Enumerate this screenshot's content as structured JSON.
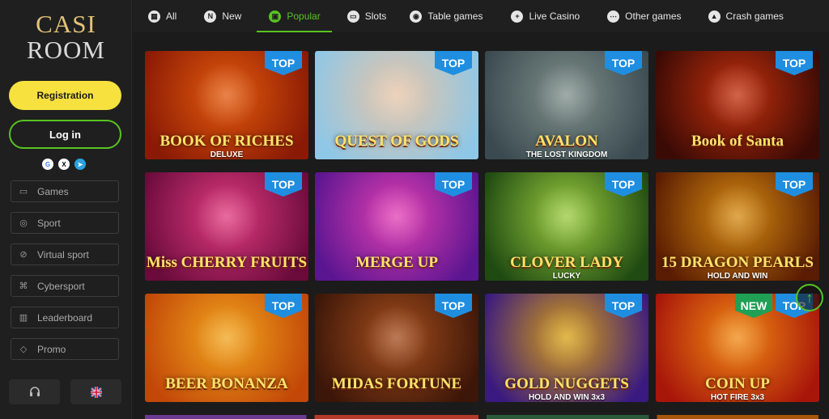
{
  "logo": {
    "line1": "CASI",
    "line2": "ROOM"
  },
  "sidebar": {
    "registration_label": "Registration",
    "login_label": "Log in",
    "socials": [
      {
        "icon": "google-icon",
        "glyph": "G"
      },
      {
        "icon": "x-icon",
        "glyph": "X"
      },
      {
        "icon": "telegram-icon",
        "glyph": "➤"
      }
    ],
    "items": [
      {
        "label": "Games",
        "icon": "games-icon"
      },
      {
        "label": "Sport",
        "icon": "sport-icon"
      },
      {
        "label": "Virtual sport",
        "icon": "virtual-sport-icon"
      },
      {
        "label": "Cybersport",
        "icon": "cybersport-icon"
      },
      {
        "label": "Leaderboard",
        "icon": "leaderboard-icon"
      },
      {
        "label": "Promo",
        "icon": "promo-icon"
      }
    ],
    "support_icon": "headset-icon",
    "language_icon": "uk-flag-icon"
  },
  "tabs": [
    {
      "label": "All",
      "icon": "all-icon",
      "glyph": "▦"
    },
    {
      "label": "New",
      "icon": "new-icon",
      "glyph": "N"
    },
    {
      "label": "Popular",
      "icon": "popular-icon",
      "glyph": "▣",
      "active": true
    },
    {
      "label": "Slots",
      "icon": "slots-icon",
      "glyph": "▭"
    },
    {
      "label": "Table games",
      "icon": "table-games-icon",
      "glyph": "◉"
    },
    {
      "label": "Live Casino",
      "icon": "live-casino-icon",
      "glyph": "+"
    },
    {
      "label": "Other games",
      "icon": "other-games-icon",
      "glyph": "⋯"
    },
    {
      "label": "Crash games",
      "icon": "crash-games-icon",
      "glyph": "▲"
    }
  ],
  "games": [
    {
      "title": "BOOK OF RICHES",
      "subtitle": "DELUXE",
      "badge": "TOP",
      "bg": [
        "#8a1a05",
        "#e25a0c"
      ]
    },
    {
      "title": "QUEST OF GODS",
      "subtitle": "",
      "badge": "TOP",
      "bg": [
        "#8fc7e6",
        "#e7c4a6"
      ]
    },
    {
      "title": "AVALON",
      "subtitle": "THE LOST KINGDOM",
      "badge": "TOP",
      "bg": [
        "#3a4a50",
        "#7f8f8a"
      ]
    },
    {
      "title": "Book of Santa",
      "subtitle": "",
      "badge": "TOP",
      "bg": [
        "#3a0a05",
        "#c2300c"
      ]
    },
    {
      "title": "Miss CHERRY FRUITS",
      "subtitle": "",
      "badge": "TOP",
      "bg": [
        "#6a0b3c",
        "#e03a7e"
      ]
    },
    {
      "title": "MERGE UP",
      "subtitle": "",
      "badge": "TOP",
      "bg": [
        "#5a1590",
        "#e23fb2"
      ]
    },
    {
      "title": "CLOVER LADY",
      "subtitle": "LUCKY",
      "badge": "TOP",
      "bg": [
        "#1f4a12",
        "#9acb3e"
      ]
    },
    {
      "title": "15 DRAGON PEARLS",
      "subtitle": "HOLD AND WIN",
      "badge": "TOP",
      "bg": [
        "#5a1c02",
        "#d68a10"
      ]
    },
    {
      "title": "BEER BONANZA",
      "subtitle": "",
      "badge": "TOP",
      "bg": [
        "#c24708",
        "#f1a41c"
      ]
    },
    {
      "title": "MIDAS FORTUNE",
      "subtitle": "",
      "badge": "TOP",
      "bg": [
        "#3c1608",
        "#a44d1c"
      ]
    },
    {
      "title": "GOLD NUGGETS",
      "subtitle": "HOLD AND WIN 3x3",
      "badge": "TOP",
      "bg": [
        "#3a1a80",
        "#d8a012"
      ]
    },
    {
      "title": "COIN UP",
      "subtitle": "HOT FIRE 3x3",
      "badge": "TOP",
      "badge2": "NEW",
      "bg": [
        "#a8160a",
        "#f08a12"
      ]
    }
  ]
}
